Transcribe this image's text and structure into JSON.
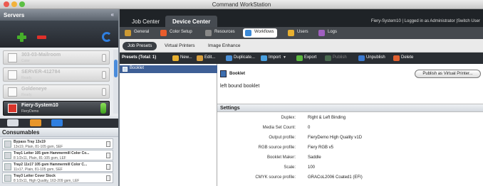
{
  "window": {
    "title": "Command WorkStation"
  },
  "servers": {
    "header": "Servers",
    "items": [
      {
        "name": "303-03-Mailroom",
        "sub": "Color",
        "state": "disabled"
      },
      {
        "name": "SERVER-412784",
        "sub": "Ready",
        "state": "disabled"
      },
      {
        "name": "Goldeneye",
        "sub": "Ready",
        "state": "disabled"
      },
      {
        "name": "Fiery-System10",
        "sub": "FieryDemo",
        "state": "selected"
      }
    ]
  },
  "consumables": {
    "header": "Consumables",
    "items": [
      {
        "title": "Bypass Tray 13x19",
        "detail": "13x19, Plain, 81-105 gsm, SEF"
      },
      {
        "title": "Tray1 Letter 105 gsm Hammermill Color Co...",
        "detail": "8 1/2x11, Plain, 81-105 gsm, LEF"
      },
      {
        "title": "Tray2 11x17 105 gsm Hammermill Color C...",
        "detail": "11x17, Plain, 81-105 gsm, SEF"
      },
      {
        "title": "Tray3 Letter Cover Stock",
        "detail": "8 1/2x11, High Quality, 163-209 gsm, LEF"
      }
    ]
  },
  "top_tabs": [
    "Job Center",
    "Device Center"
  ],
  "user_info": "Fiery-System10 | Logged in as Administrator |Switch User",
  "module_tabs": [
    {
      "label": "General",
      "icon": "general-icon",
      "color": "#cc9933"
    },
    {
      "label": "Color Setup",
      "icon": "color-setup-icon",
      "color": "#e85c2c"
    },
    {
      "label": "Resources",
      "icon": "resources-icon",
      "color": "#888888"
    },
    {
      "label": "Workflows",
      "icon": "workflows-icon",
      "color": "#3c8ad8"
    },
    {
      "label": "Users",
      "icon": "users-icon",
      "color": "#e8b030"
    },
    {
      "label": "Logs",
      "icon": "logs-icon",
      "color": "#a060c0"
    }
  ],
  "sub_tabs": [
    "Job Presets",
    "Virtual Printers",
    "Image Enhance"
  ],
  "toolbar": {
    "presets_label": "Presets  (Total: 1)",
    "new": "New...",
    "edit": "Edit...",
    "duplicate": "Duplicate...",
    "import": "Import",
    "export": "Export",
    "publish": "Publish",
    "unpublish": "Unpublish",
    "delete": "Delete"
  },
  "presets": [
    {
      "name": "Booklet"
    }
  ],
  "detail": {
    "name": "Booklet",
    "description": "left bound booklet",
    "publish_button": "Publish as Virtual Printer...",
    "settings_header": "Settings",
    "settings": [
      {
        "label": "Duplex:",
        "value": "Right & Left Binding"
      },
      {
        "label": "Media Set Count:",
        "value": "0"
      },
      {
        "label": "Output profile:",
        "value": "FieryDemo High Quality v1D"
      },
      {
        "label": "RGB source profile:",
        "value": "Fiery RGB v5"
      },
      {
        "label": "Booklet Maker:",
        "value": "Saddle"
      },
      {
        "label": "Scale:",
        "value": "100"
      },
      {
        "label": "CMYK source profile:",
        "value": "GRACoL2006 Coated1 (EFI)"
      }
    ]
  }
}
